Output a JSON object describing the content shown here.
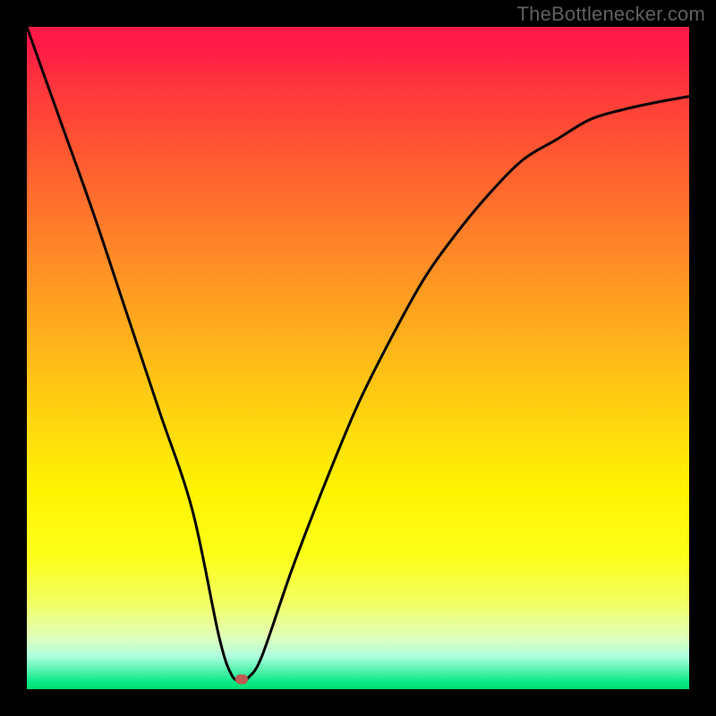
{
  "watermark": "TheBottlenecker.com",
  "chart_data": {
    "type": "line",
    "title": "",
    "xlabel": "",
    "ylabel": "",
    "xlim": [
      0,
      1
    ],
    "ylim": [
      0,
      1
    ],
    "series": [
      {
        "name": "bottleneck-curve",
        "x": [
          0.0,
          0.05,
          0.1,
          0.15,
          0.2,
          0.25,
          0.29,
          0.31,
          0.325,
          0.335,
          0.355,
          0.4,
          0.45,
          0.5,
          0.55,
          0.6,
          0.65,
          0.7,
          0.75,
          0.8,
          0.85,
          0.9,
          0.95,
          1.0
        ],
        "values": [
          1.0,
          0.86,
          0.72,
          0.57,
          0.42,
          0.27,
          0.08,
          0.02,
          0.015,
          0.018,
          0.05,
          0.18,
          0.31,
          0.43,
          0.53,
          0.62,
          0.69,
          0.75,
          0.8,
          0.83,
          0.86,
          0.875,
          0.886,
          0.895
        ]
      }
    ],
    "marker": {
      "x": 0.324,
      "y": 0.015,
      "label": "optimal-point"
    },
    "gradient_stops": [
      {
        "pos": 0.0,
        "color": "#ff1a47"
      },
      {
        "pos": 0.5,
        "color": "#ffd80e"
      },
      {
        "pos": 0.8,
        "color": "#fcff1a"
      },
      {
        "pos": 1.0,
        "color": "#00e070"
      }
    ]
  }
}
